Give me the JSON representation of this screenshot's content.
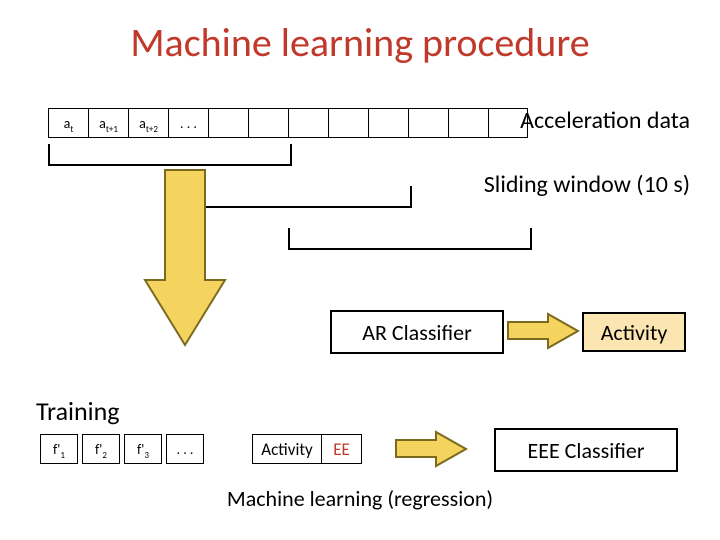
{
  "title": "Machine learning procedure",
  "accel_label": "Acceleration data",
  "sw_label": "Sliding window (10 s)",
  "ar_classifier": "AR Classifier",
  "activity": "Activity",
  "training": "Training",
  "activity2": "Activity",
  "ee": "EE",
  "eee_classifier": "EEE Classifier",
  "ml_reg": "Machine learning (regression)",
  "cells": [
    {
      "main": "a",
      "sub": "t"
    },
    {
      "main": "a",
      "sub": "t+1"
    },
    {
      "main": "a",
      "sub": "t+2"
    },
    {
      "main": ". . .",
      "sub": ""
    },
    {
      "main": "",
      "sub": ""
    },
    {
      "main": "",
      "sub": ""
    },
    {
      "main": "",
      "sub": ""
    },
    {
      "main": "",
      "sub": ""
    },
    {
      "main": "",
      "sub": ""
    },
    {
      "main": "",
      "sub": ""
    },
    {
      "main": "",
      "sub": ""
    },
    {
      "main": "",
      "sub": ""
    }
  ],
  "fcells": [
    {
      "main": "f'",
      "sub": "1"
    },
    {
      "main": "f'",
      "sub": "2"
    },
    {
      "main": "f'",
      "sub": "3"
    },
    {
      "main": ". . .",
      "sub": ""
    }
  ]
}
